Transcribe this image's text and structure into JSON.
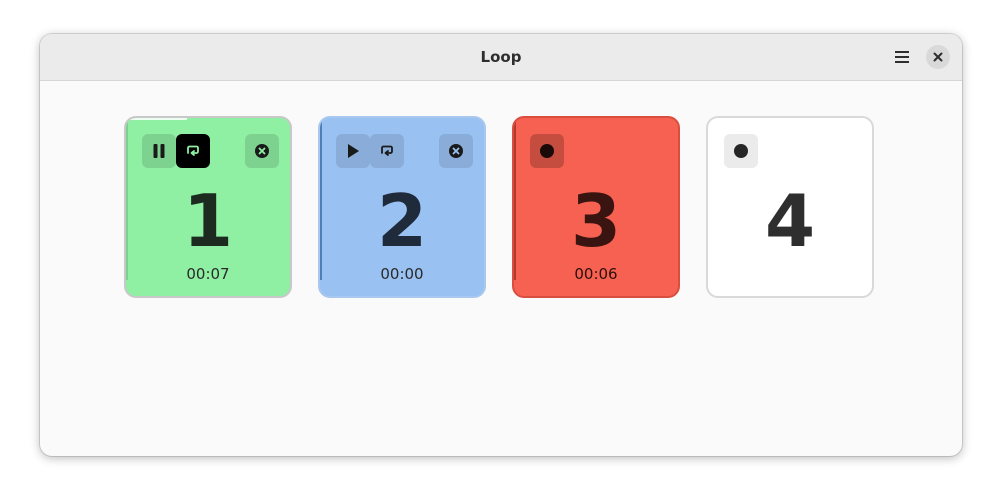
{
  "window": {
    "title": "Loop",
    "menu_icon": "hamburger-menu-icon",
    "close_icon": "close-icon"
  },
  "cards": [
    {
      "number": "1",
      "time": "00:07",
      "color": "#8ff0a4",
      "progress": 0.37,
      "buttons": [
        "pause-icon",
        "loop-icon",
        "remove-icon"
      ],
      "loop_active": true
    },
    {
      "number": "2",
      "time": "00:00",
      "color": "#99c1f1",
      "buttons": [
        "play-icon",
        "loop-icon",
        "remove-icon"
      ],
      "loop_active": false
    },
    {
      "number": "3",
      "time": "00:06",
      "color": "#f66151",
      "buttons": [
        "record-icon"
      ]
    },
    {
      "number": "4",
      "color": "#ffffff",
      "buttons": [
        "record-icon"
      ]
    }
  ]
}
